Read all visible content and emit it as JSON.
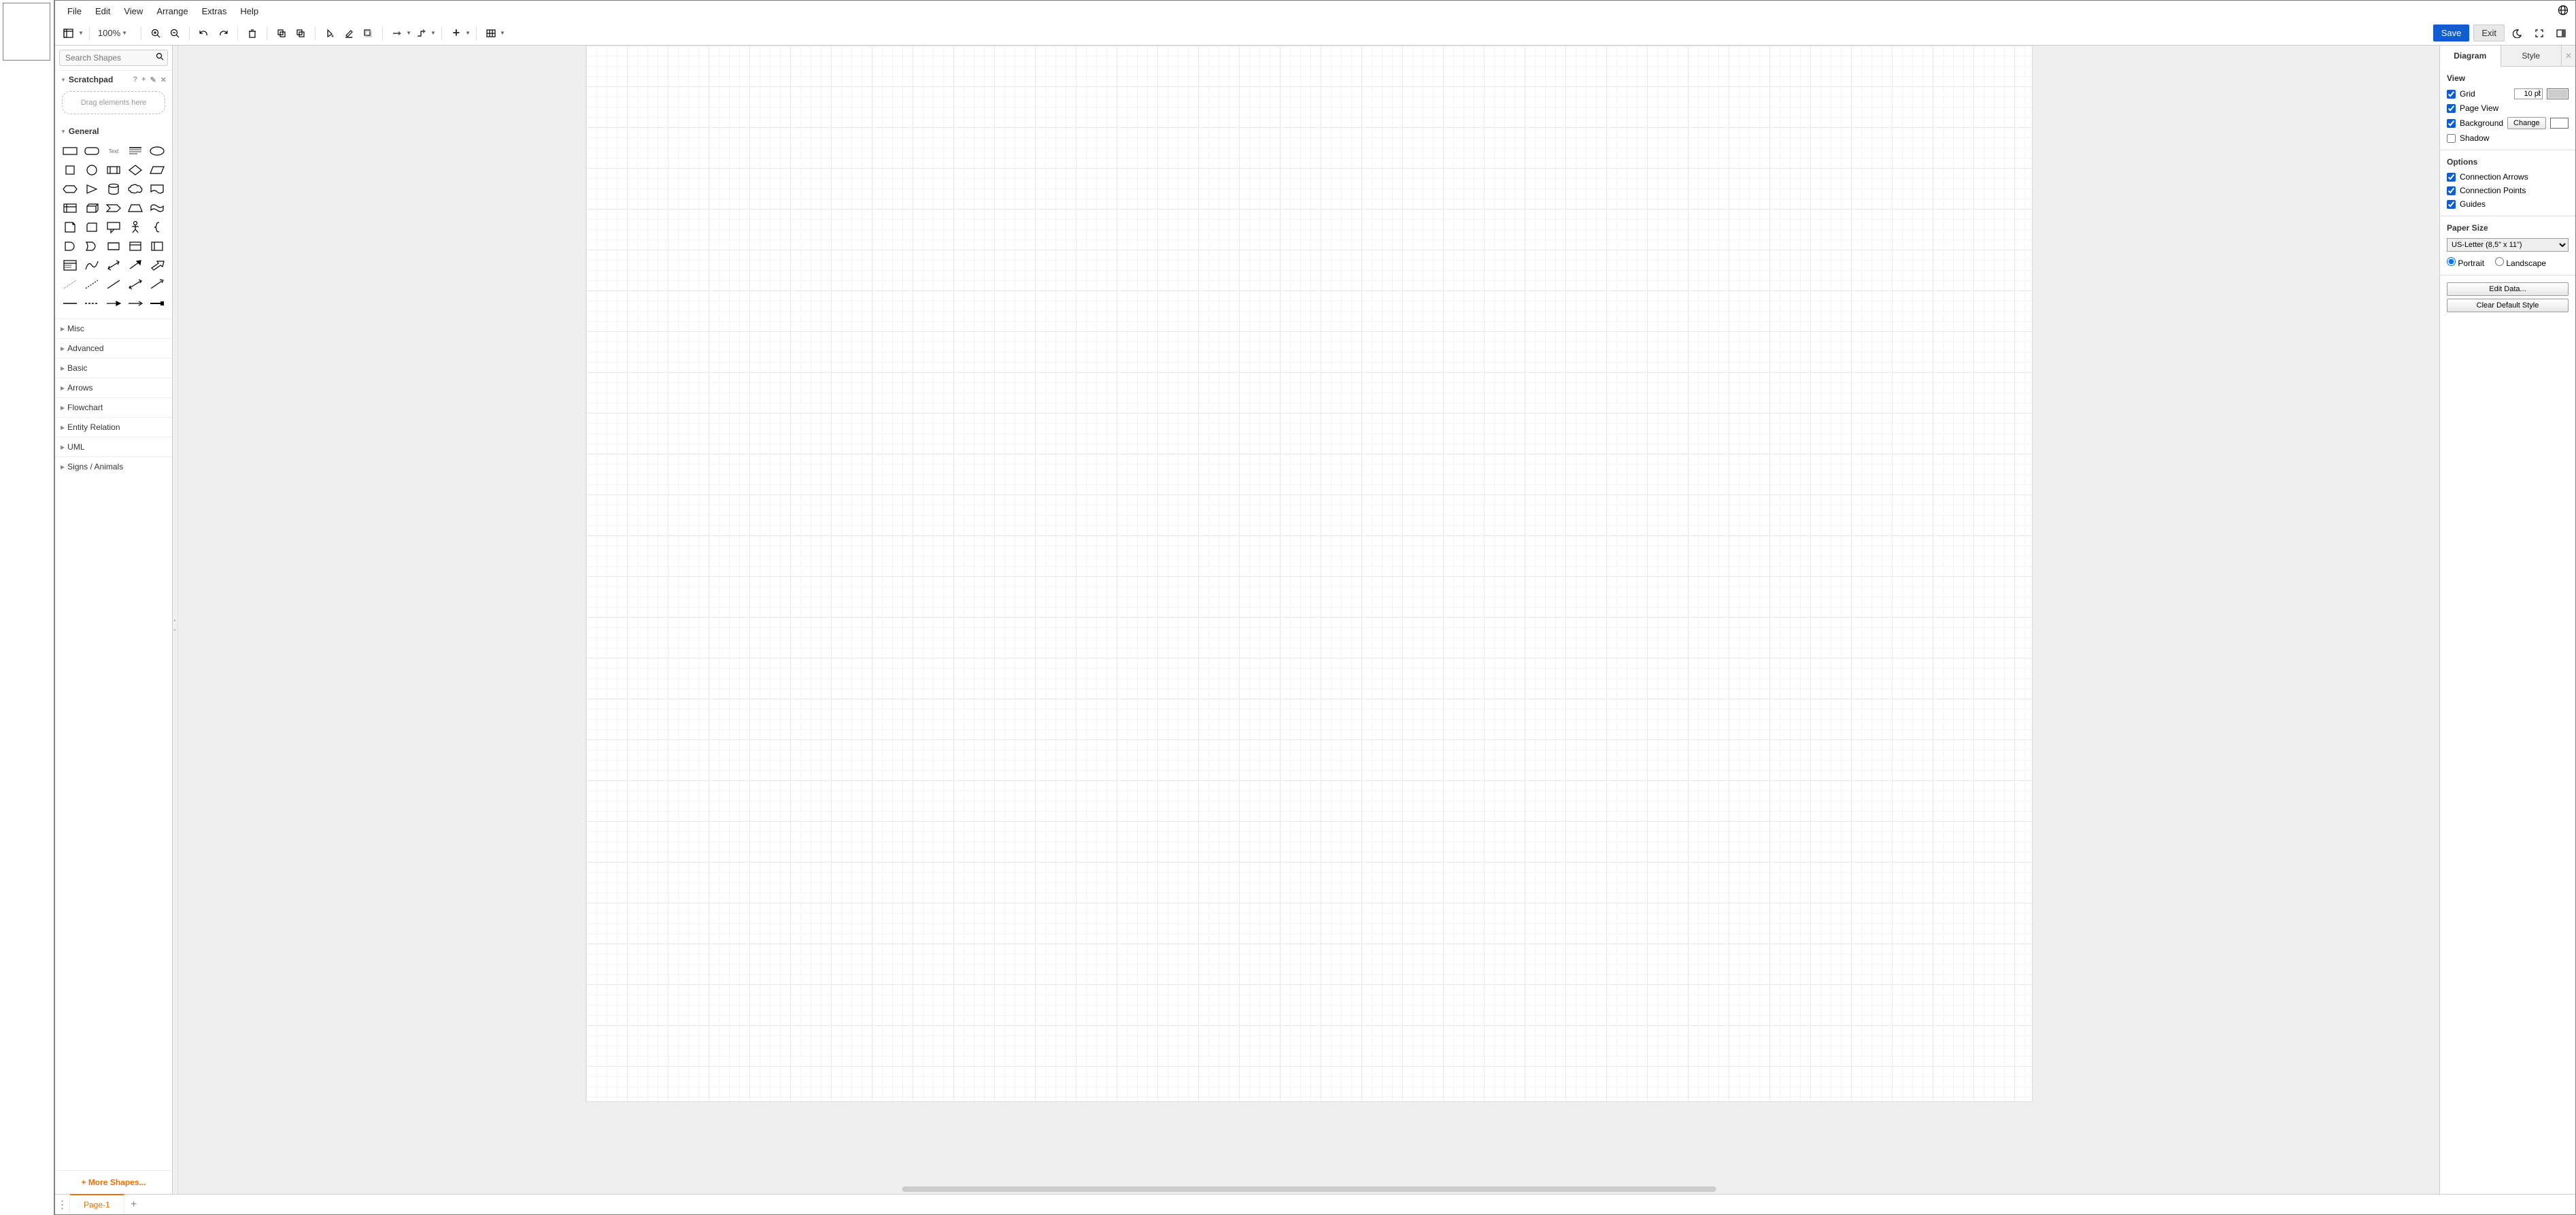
{
  "menubar": [
    "File",
    "Edit",
    "View",
    "Arrange",
    "Extras",
    "Help"
  ],
  "toolbar": {
    "zoom": "100%",
    "save": "Save",
    "exit": "Exit"
  },
  "sidebar": {
    "search_placeholder": "Search Shapes",
    "scratchpad": {
      "title": "Scratchpad",
      "drop_hint": "Drag elements here"
    },
    "sections": {
      "general": "General",
      "categories": [
        "Misc",
        "Advanced",
        "Basic",
        "Arrows",
        "Flowchart",
        "Entity Relation",
        "UML",
        "Signs / Animals"
      ]
    },
    "more_shapes": "More Shapes..."
  },
  "panel": {
    "tabs": {
      "diagram": "Diagram",
      "style": "Style"
    },
    "view": {
      "heading": "View",
      "grid": "Grid",
      "grid_size": "10 pt",
      "page_view": "Page View",
      "background": "Background",
      "change": "Change",
      "shadow": "Shadow"
    },
    "options": {
      "heading": "Options",
      "connection_arrows": "Connection Arrows",
      "connection_points": "Connection Points",
      "guides": "Guides"
    },
    "paper": {
      "heading": "Paper Size",
      "selected": "US-Letter (8,5\" x 11\")",
      "portrait": "Portrait",
      "landscape": "Landscape"
    },
    "edit_data": "Edit Data...",
    "clear_style": "Clear Default Style"
  },
  "bottom": {
    "page": "Page-1"
  },
  "shape_text_label": "Text"
}
